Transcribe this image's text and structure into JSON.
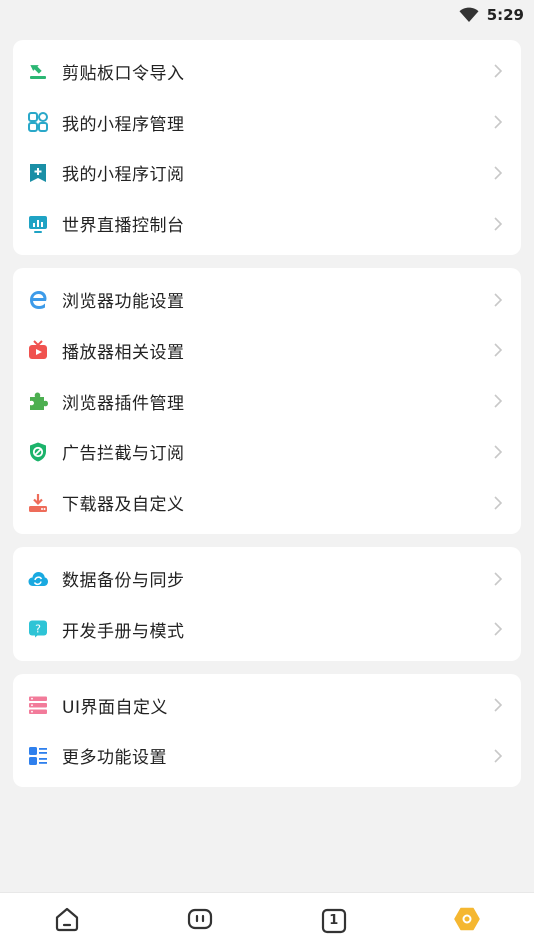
{
  "status": {
    "time": "5:29"
  },
  "groups": [
    {
      "items": [
        {
          "label": "剪贴板口令导入",
          "icon": "clipboard-import-icon"
        },
        {
          "label": "我的小程序管理",
          "icon": "mini-program-grid-icon"
        },
        {
          "label": "我的小程序订阅",
          "icon": "subscribe-bookmark-icon"
        },
        {
          "label": "世界直播控制台",
          "icon": "live-monitor-icon"
        }
      ]
    },
    {
      "items": [
        {
          "label": "浏览器功能设置",
          "icon": "browser-e-icon"
        },
        {
          "label": "播放器相关设置",
          "icon": "tv-player-icon"
        },
        {
          "label": "浏览器插件管理",
          "icon": "puzzle-plugin-icon"
        },
        {
          "label": "广告拦截与订阅",
          "icon": "ad-block-shield-icon"
        },
        {
          "label": "下载器及自定义",
          "icon": "download-tray-icon"
        }
      ]
    },
    {
      "items": [
        {
          "label": "数据备份与同步",
          "icon": "cloud-sync-icon"
        },
        {
          "label": "开发手册与模式",
          "icon": "help-bubble-icon"
        }
      ]
    },
    {
      "items": [
        {
          "label": "UI界面自定义",
          "icon": "ui-layers-icon"
        },
        {
          "label": "更多功能设置",
          "icon": "list-settings-icon"
        }
      ]
    }
  ],
  "bottom_nav": {
    "tab_count": "1",
    "items": [
      "home-icon",
      "ai-bot-icon",
      "tabs-count-icon",
      "settings-hex-icon"
    ]
  },
  "colors": {
    "background": "#f2f2f2",
    "card": "#ffffff",
    "accent_yellow": "#f5b731"
  }
}
